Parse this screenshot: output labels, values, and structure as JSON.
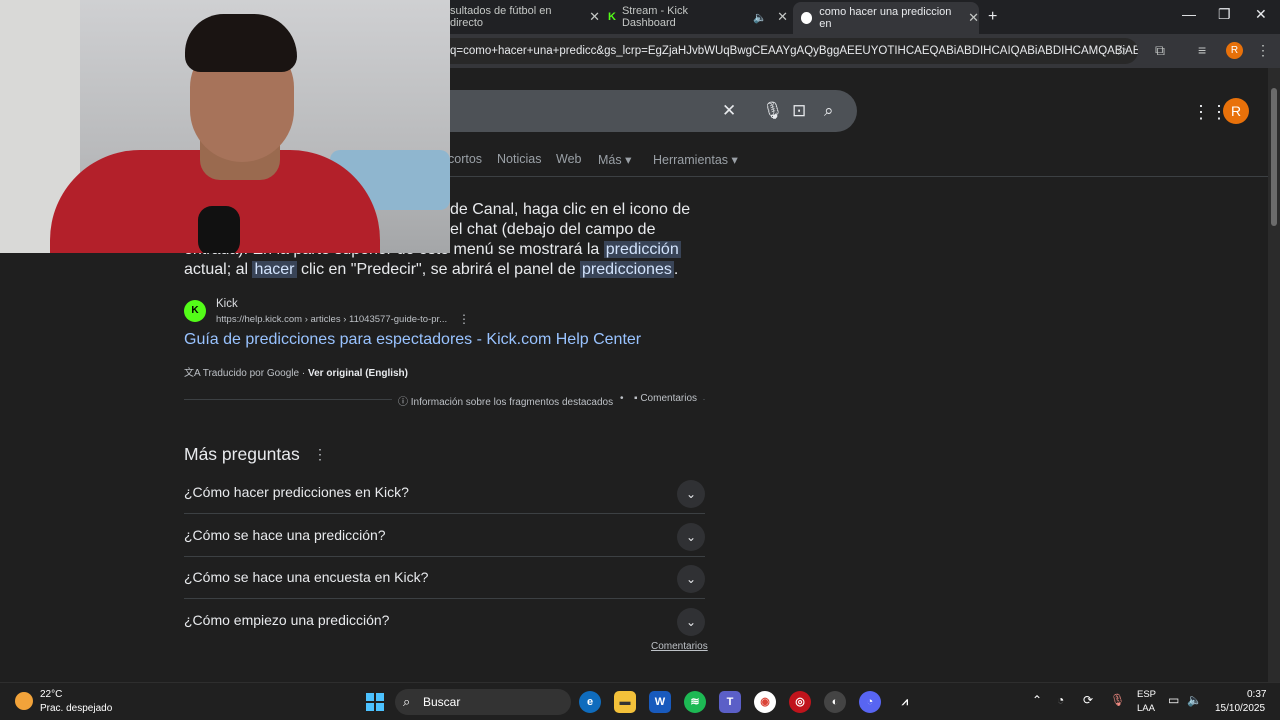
{
  "browser": {
    "tabs": [
      {
        "label": "sultados de fútbol en directo",
        "audio": false,
        "active": false
      },
      {
        "label": "Stream - Kick Dashboard",
        "audio": true,
        "active": false
      },
      {
        "label": "como hacer una prediccion en",
        "audio": false,
        "active": true
      }
    ],
    "new_tab_label": "+",
    "address": "q=como+hacer+una+predicc&gs_lcrp=EgZjaHJvbWUqBwgCEAAYgAQyBggAEEUYOTIHCAEQABiABDIHCAIQABiABDIHCAMQABiAB...",
    "profile_initial": "R"
  },
  "search": {
    "nav_tabs": [
      "cortos",
      "Noticias",
      "Web",
      "Más ▾",
      "Herramientas ▾"
    ],
    "profile_initial": "R"
  },
  "snippet": {
    "line1": "de Canal, haga clic en el icono de",
    "line2": "el chat (debajo del campo de",
    "line3_pre": "entrada). En la parte superior de este menú se mostrará la ",
    "line3_hl": "predicción",
    "line4_a": "actual; al ",
    "line4_hl1": "hacer",
    "line4_b": " clic en \"Predecir\", se abrirá el panel de ",
    "line4_hl2": "predicciones",
    "line4_c": "."
  },
  "source": {
    "favicon": "K",
    "name": "Kick",
    "url": "https://help.kick.com › articles › 11043577-guide-to-pr...",
    "title": "Guía de predicciones para espectadores - Kick.com Help Center",
    "translated_by": "Traducido por Google · ",
    "original_link": "Ver original (English)",
    "info_label": "Información sobre los fragmentos destacados",
    "feedback_label": "Comentarios"
  },
  "more_questions": {
    "title": "Más preguntas",
    "items": [
      "¿Cómo hacer predicciones en Kick?",
      "¿Cómo se hace una predicción?",
      "¿Cómo se hace una encuesta en Kick?",
      "¿Cómo empiezo una predicción?"
    ],
    "feedback_label": "Comentarios"
  },
  "taskbar": {
    "temperature": "22°C",
    "weather": "Prac. despejado",
    "search_label": "Buscar",
    "language_top": "ESP",
    "language_bottom": "LAA",
    "time": "0:37",
    "date": "15/10/2025"
  }
}
